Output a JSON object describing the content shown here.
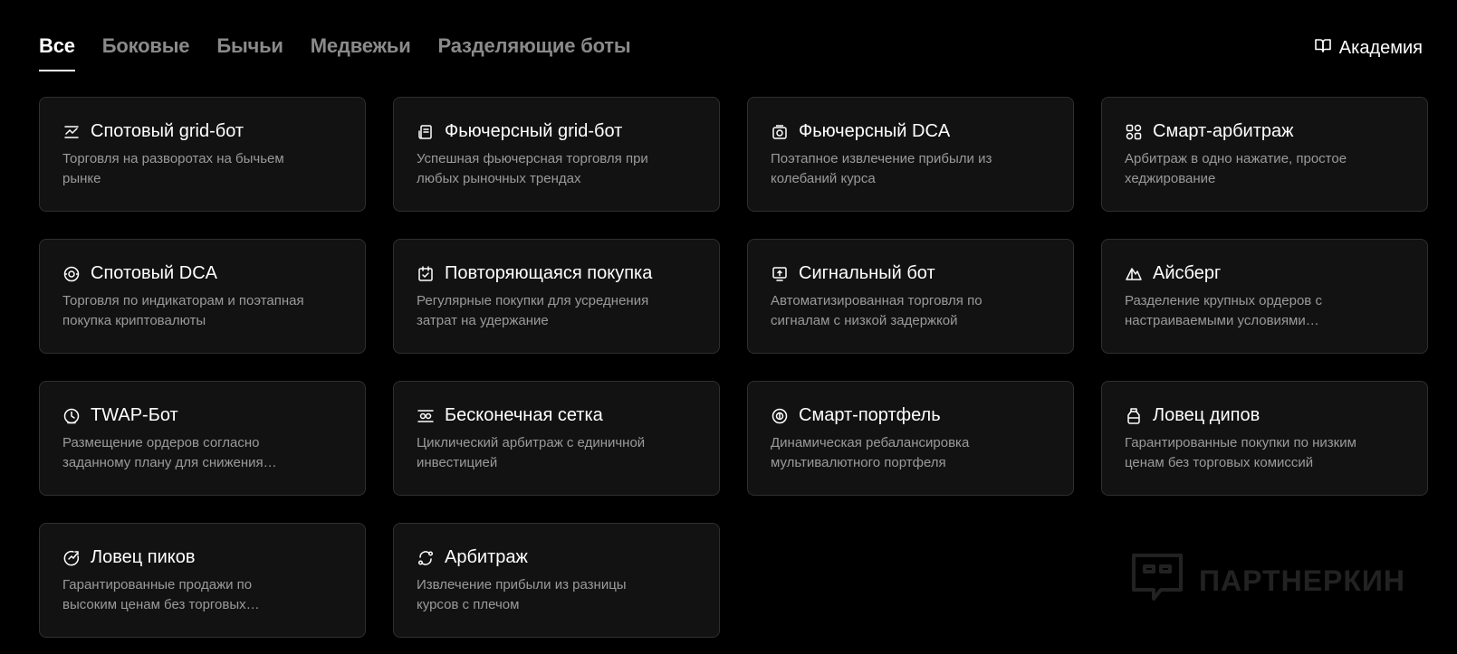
{
  "tabs": [
    {
      "label": "Все",
      "active": true
    },
    {
      "label": "Боковые",
      "active": false
    },
    {
      "label": "Бычьи",
      "active": false
    },
    {
      "label": "Медвежьи",
      "active": false
    },
    {
      "label": "Разделяющие боты",
      "active": false
    }
  ],
  "academy": {
    "label": "Академия",
    "icon": "book-icon"
  },
  "cards": [
    {
      "title": "Спотовый grid-бот",
      "desc": "Торговля на разворотах на бычьем рынке",
      "icon": "chart-grid-icon"
    },
    {
      "title": "Фьючерсный grid-бот",
      "desc": "Успешная фьючерсная торговля при любых рыночных трендах",
      "icon": "document-icon"
    },
    {
      "title": "Фьючерсный DCA",
      "desc": "Поэтапное извлечение прибыли из колебаний курса",
      "icon": "coin-stack-icon"
    },
    {
      "title": "Смарт-арбитраж",
      "desc": "Арбитраж в одно нажатие, простое хеджирование",
      "icon": "arbitrage-nodes-icon"
    },
    {
      "title": "Спотовый DCA",
      "desc": "Торговля по индикаторам и поэтапная покупка криптовалюты",
      "icon": "target-coin-icon"
    },
    {
      "title": "Повторяющаяся покупка",
      "desc": "Регулярные покупки для усреднения затрат на удержание",
      "icon": "calendar-check-icon"
    },
    {
      "title": "Сигнальный бот",
      "desc": "Автоматизированная торговля по сигналам с низкой задержкой",
      "icon": "signal-screen-icon"
    },
    {
      "title": "Айсберг",
      "desc": "Разделение крупных ордеров с настраиваемыми условиями исполнения",
      "icon": "iceberg-icon"
    },
    {
      "title": "TWAP-Бот",
      "desc": "Размещение ордеров согласно заданному плану для снижения влияния на рынок",
      "icon": "clock-icon"
    },
    {
      "title": "Бесконечная сетка",
      "desc": "Циклический арбитраж с единичной инвестицией",
      "icon": "infinite-grid-icon"
    },
    {
      "title": "Смарт-портфель",
      "desc": "Динамическая ребалансировка мультивалютного портфеля",
      "icon": "portfolio-coin-icon"
    },
    {
      "title": "Ловец дипов",
      "desc": "Гарантированные покупки по низким ценам без торговых комиссий",
      "icon": "jar-icon"
    },
    {
      "title": "Ловец пиков",
      "desc": "Гарантированные продажи по высоким ценам без торговых комиссий",
      "icon": "peak-gauge-icon"
    },
    {
      "title": "Арбитраж",
      "desc": "Извлечение прибыли из разницы курсов с плечом",
      "icon": "cycle-icon"
    }
  ],
  "watermark": {
    "text": "ПАРТНЕРКИН"
  },
  "colors": {
    "background": "#000000",
    "card": "#121212",
    "card_border": "#2f2f2f",
    "muted_text": "#9a9a9a",
    "inactive_tab": "#8a8a8a"
  }
}
